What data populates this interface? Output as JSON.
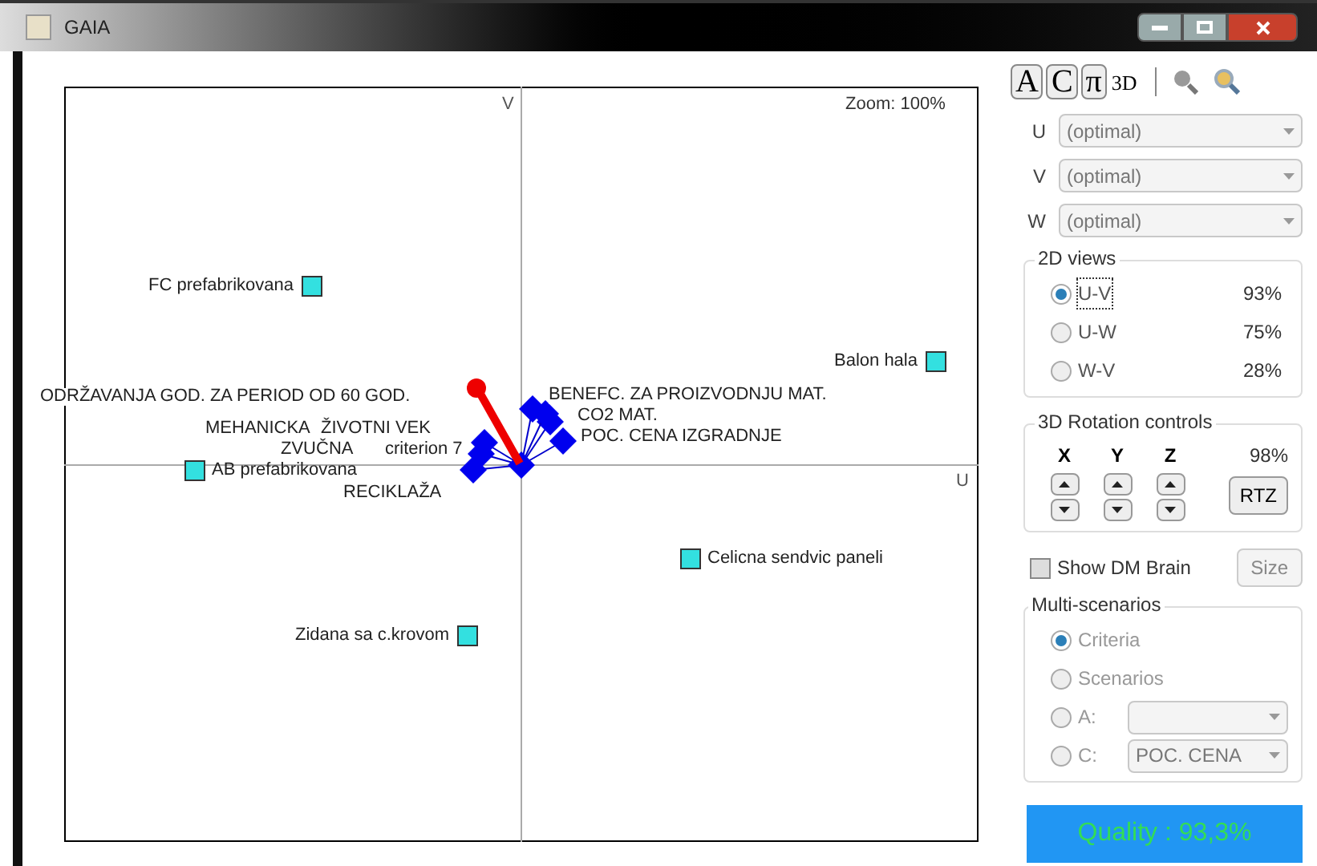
{
  "window": {
    "title": "GAIA"
  },
  "toolbar": {
    "buttons": [
      {
        "label": "A"
      },
      {
        "label": "C"
      },
      {
        "label": "π"
      },
      {
        "label": "3D"
      }
    ]
  },
  "plot": {
    "axis_v": "V",
    "axis_u": "U",
    "zoom": "Zoom: 100%",
    "alternatives": [
      {
        "label": "FC prefabrikovana",
        "color": "#33e0e0"
      },
      {
        "label": "Balon hala",
        "color": "#33e0e0"
      },
      {
        "label": "AB prefabrikovana",
        "color": "#33e0e0"
      },
      {
        "label": "Celicna sendvic paneli",
        "color": "#33e0e0"
      },
      {
        "label": "Zidana sa c.krovom",
        "color": "#33e0e0"
      }
    ],
    "criteria": [
      {
        "label": "ODRŽAVANJA GOD. ZA PERIOD OD 60 GOD."
      },
      {
        "label": "BENEFC. ZA PROIZVODNJU MAT."
      },
      {
        "label": "CO2 MAT."
      },
      {
        "label": "MEHANICKA"
      },
      {
        "label": "ŽIVOTNI VEK"
      },
      {
        "label": "POC. CENA IZGRADNJE"
      },
      {
        "label": "ZVUČNA"
      },
      {
        "label": "criterion 7"
      },
      {
        "label": "RECIKLAŽA"
      }
    ]
  },
  "axes": [
    {
      "label": "U",
      "value": "(optimal)"
    },
    {
      "label": "V",
      "value": "(optimal)"
    },
    {
      "label": "W",
      "value": "(optimal)"
    }
  ],
  "views_2d": {
    "title": "2D views",
    "items": [
      {
        "label": "U-V",
        "value": "93%",
        "selected": true
      },
      {
        "label": "U-W",
        "value": "75%",
        "selected": false
      },
      {
        "label": "W-V",
        "value": "28%",
        "selected": false
      }
    ]
  },
  "rotation": {
    "title": "3D Rotation controls",
    "axes": [
      "X",
      "Y",
      "Z"
    ],
    "value": "98%",
    "button": "RTZ"
  },
  "dm_brain": {
    "label": "Show DM Brain",
    "checked": false,
    "button": "Size"
  },
  "multi": {
    "title": "Multi-scenarios",
    "items": [
      {
        "kind": "radio",
        "label": "Criteria",
        "selected": true
      },
      {
        "kind": "radio",
        "label": "Scenarios",
        "selected": false
      },
      {
        "kind": "select",
        "label": "A:",
        "selected": false
      },
      {
        "kind": "select",
        "label": "C:",
        "value": "POC. CENA",
        "selected": false
      }
    ]
  },
  "quality": "Quality : 93,3%"
}
